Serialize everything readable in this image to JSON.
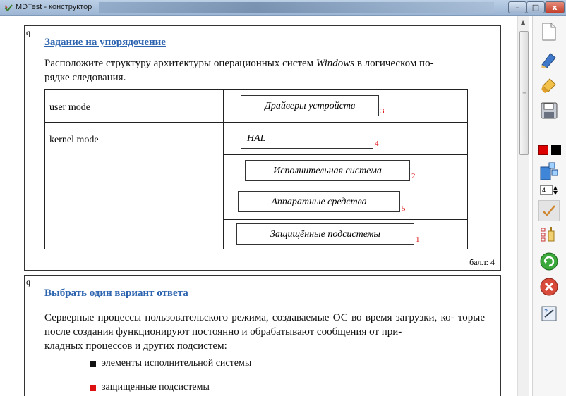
{
  "window": {
    "title": "MDTest - конструктор",
    "buttons": {
      "minimize": "–",
      "maximize": "□",
      "close": "x"
    }
  },
  "question1": {
    "marker": "q",
    "title": "Задание на упорядочение",
    "text_line1": "Расположите структуру архитектуры операционных систем Windows в логическом по-",
    "text_line2": "рядке следования.",
    "rows": [
      {
        "label": "user mode"
      },
      {
        "label": "kernel mode"
      }
    ],
    "items": [
      {
        "text": "Драйверы устройств",
        "num": "3"
      },
      {
        "text": "HAL",
        "num": "4"
      },
      {
        "text": "Исполнительная система",
        "num": "2"
      },
      {
        "text": "Аппаратные средства",
        "num": "5"
      },
      {
        "text": "Защищённые подсистемы",
        "num": "1"
      }
    ],
    "score": "балл: 4"
  },
  "question2": {
    "marker": "q",
    "title": "Выбрать один вариант ответа",
    "text_line1": "Серверные процессы пользовательского режима, создаваемые ОС во время загрузки, ко-",
    "text_line2": "торые после создания функционируют постоянно и обрабатывают сообщения от при-",
    "text_line3": "кладных процессов и других подсистем:",
    "options": [
      {
        "text": "элементы исполнительной системы",
        "color": "#111111"
      },
      {
        "text": "защищенные подсистемы",
        "color": "#dd1111"
      }
    ]
  },
  "toolbar": {
    "icons": [
      "new-document-icon",
      "edit-icon",
      "clear-icon",
      "save-icon",
      "color-picker-icon",
      "structure-icon",
      "spin-value",
      "check-icon",
      "list-icon",
      "refresh-icon",
      "close-icon",
      "help-icon"
    ],
    "color_swatches": [
      "#dd0000",
      "#000000"
    ],
    "spin_value": "4"
  },
  "accent": "#2d64b0",
  "number_color": "#d11111"
}
